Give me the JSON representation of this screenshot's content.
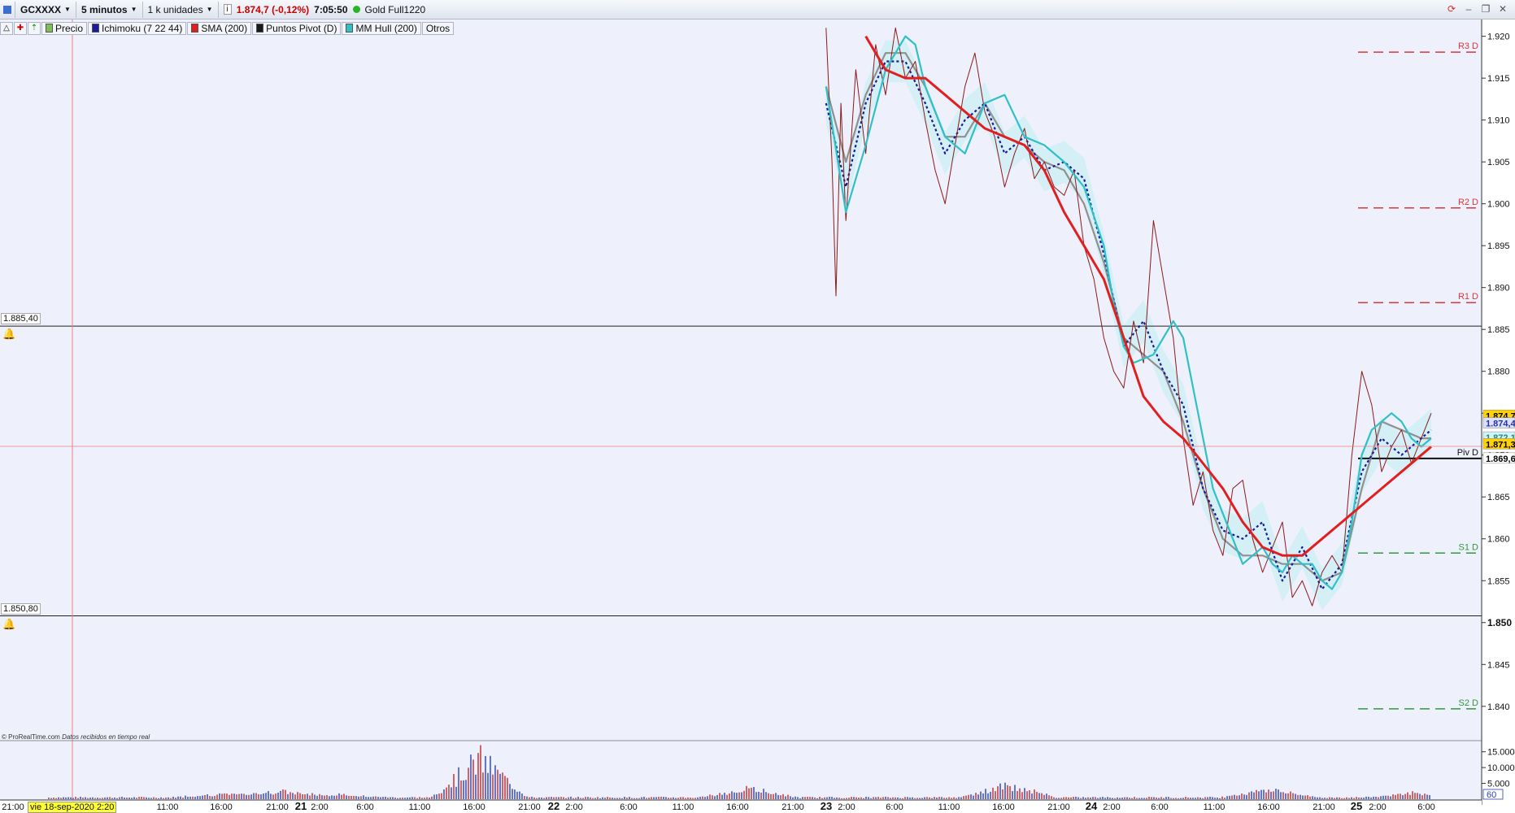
{
  "toolbar": {
    "symbol": "GCXXXX",
    "timeframe": "5 minutos",
    "units": "1 k unidades",
    "price_change": "1.874,7 (-0,12%)",
    "time": "7:05:50",
    "instrument": "Gold Full1220"
  },
  "indicators": {
    "items": [
      "Precio",
      "Ichimoku (7 22 44)",
      "SMA (200)",
      "Puntos Pivot (D)",
      "MM Hull (200)",
      "Otros"
    ],
    "colors": [
      "#7fbf5a",
      "#1a1a9a",
      "#e02020",
      "#1a1a1a",
      "#30c0c8",
      null
    ]
  },
  "credit": {
    "source": "© ProRealTime.com",
    "note": "Datos recibidos en tiempo real"
  },
  "cursor": {
    "date_label": "vie 18-sep-2020 2:20"
  },
  "hlines": [
    {
      "label": "1.885,40",
      "value": 1885.4
    },
    {
      "label": "1.850,80",
      "value": 1850.8
    }
  ],
  "price_labels": [
    {
      "text": "1.874,7",
      "value": 1874.7,
      "bg": "#ffd200",
      "fg": "#000"
    },
    {
      "text": "1.874,4",
      "value": 1873.8,
      "bg": "#dde0f8",
      "fg": "#2233aa"
    },
    {
      "text": "1.872,1",
      "value": 1872.1,
      "bg": "#d2f4f4",
      "fg": "#228888"
    },
    {
      "text": "1.871,3",
      "value": 1871.3,
      "bg": "#ffd200",
      "fg": "#000"
    },
    {
      "text": "1.869,6",
      "value": 1869.6,
      "bg": "#ffffff",
      "fg": "#000"
    }
  ],
  "pivots": [
    {
      "label": "R3 D",
      "value_label": "1.918,1",
      "value": 1918.1,
      "color": "#d83a3a"
    },
    {
      "label": "R2 D",
      "value_label": "1.899,5",
      "value": 1899.5,
      "color": "#d83a3a"
    },
    {
      "label": "R1 D",
      "value_label": "1.888,2",
      "value": 1888.2,
      "color": "#d83a3a"
    },
    {
      "label": "Piv D",
      "value_label": "",
      "value": 1869.6,
      "color": "#111111"
    },
    {
      "label": "S1 D",
      "value_label": "1.858,3",
      "value": 1858.3,
      "color": "#2e9a3e"
    },
    {
      "label": "S2 D",
      "value_label": "1.839,7",
      "value": 1839.7,
      "color": "#2e9a3e"
    }
  ],
  "chart_data": {
    "type": "line",
    "ylim": [
      1836,
      1922
    ],
    "y_ticks": [
      "1.920",
      "1.915",
      "1.910",
      "1.905",
      "1.900",
      "1.895",
      "1.890",
      "1.885",
      "1.880",
      "1.875",
      "1.870",
      "1.865",
      "1.860",
      "1.855",
      "1.850",
      "1.845",
      "1.840"
    ],
    "y_tick_values": [
      1920,
      1915,
      1910,
      1905,
      1900,
      1895,
      1890,
      1885,
      1880,
      1875,
      1870,
      1865,
      1860,
      1855,
      1850,
      1845,
      1840
    ],
    "bold_tick": "1.850",
    "x_ticks": [
      {
        "label": "21:00",
        "bold": false
      },
      {
        "label": "21",
        "bold": true
      },
      {
        "label": "2:00",
        "bold": false
      },
      {
        "label": "6:00",
        "bold": false
      },
      {
        "label": "11:00",
        "bold": false
      },
      {
        "label": "16:00",
        "bold": false
      },
      {
        "label": "21:00",
        "bold": false
      },
      {
        "label": "22",
        "bold": true
      },
      {
        "label": "2:00",
        "bold": false
      },
      {
        "label": "6:00",
        "bold": false
      },
      {
        "label": "11:00",
        "bold": false
      },
      {
        "label": "16:00",
        "bold": false
      },
      {
        "label": "21:00",
        "bold": false
      },
      {
        "label": "23",
        "bold": true
      },
      {
        "label": "2:00",
        "bold": false
      },
      {
        "label": "6:00",
        "bold": false
      },
      {
        "label": "11:00",
        "bold": false
      },
      {
        "label": "16:00",
        "bold": false
      },
      {
        "label": "21:00",
        "bold": false
      },
      {
        "label": "24",
        "bold": true
      },
      {
        "label": "2:00",
        "bold": false
      },
      {
        "label": "6:00",
        "bold": false
      },
      {
        "label": "11:00",
        "bold": false
      },
      {
        "label": "16:00",
        "bold": false
      },
      {
        "label": "21:00",
        "bold": false
      },
      {
        "label": "25",
        "bold": true
      },
      {
        "label": "2:00",
        "bold": false
      },
      {
        "label": "6:00",
        "bold": false
      }
    ],
    "left_ticks": [
      {
        "label": "21:00"
      },
      {
        "label": "11:00"
      },
      {
        "label": "16:00"
      },
      {
        "label": "21:00"
      }
    ],
    "volume_ticks": [
      "15.000",
      "10.000",
      "5.000"
    ],
    "volume_tick_values": [
      15000,
      10000,
      5000
    ],
    "volume_ylim": [
      0,
      18000
    ],
    "volume_box": "60",
    "series": [
      {
        "name": "Precio",
        "color": "#8b1a1a",
        "x": [
          0.39,
          0.396,
          0.4,
          0.405,
          0.41,
          0.42,
          0.43,
          0.44,
          0.45,
          0.46,
          0.47,
          0.48,
          0.49,
          0.5,
          0.51,
          0.52,
          0.53,
          0.54,
          0.55,
          0.56,
          0.57,
          0.58,
          0.59,
          0.6,
          0.61,
          0.62,
          0.63,
          0.64,
          0.65,
          0.66,
          0.67,
          0.68,
          0.69,
          0.7,
          0.71,
          0.72,
          0.73,
          0.74,
          0.75,
          0.76,
          0.77,
          0.78,
          0.79,
          0.8,
          0.81,
          0.82,
          0.83,
          0.84,
          0.85,
          0.86,
          0.87,
          0.88,
          0.89,
          0.9,
          0.91,
          0.92,
          0.93,
          0.94,
          0.95,
          0.96,
          0.97,
          0.98,
          0.99,
          1.0
        ],
        "y": [
          1921,
          1905,
          1889,
          1912,
          1898,
          1916,
          1906,
          1919,
          1913,
          1921,
          1915,
          1917,
          1910,
          1904,
          1900,
          1907,
          1914,
          1918,
          1911,
          1908,
          1902,
          1906,
          1909,
          1903,
          1905,
          1902,
          1901,
          1904,
          1895,
          1891,
          1884,
          1880,
          1878,
          1886,
          1881,
          1898,
          1891,
          1884,
          1872,
          1864,
          1868,
          1861,
          1858,
          1866,
          1867,
          1860,
          1856,
          1859,
          1862,
          1853,
          1855,
          1852,
          1856,
          1858,
          1856,
          1870,
          1880,
          1876,
          1868,
          1871,
          1873,
          1869,
          1872,
          1875
        ]
      },
      {
        "name": "MM Hull (200)",
        "color": "#30c0c8",
        "x": [
          0.39,
          0.41,
          0.43,
          0.45,
          0.47,
          0.48,
          0.49,
          0.51,
          0.53,
          0.55,
          0.57,
          0.59,
          0.61,
          0.63,
          0.65,
          0.67,
          0.68,
          0.69,
          0.7,
          0.72,
          0.74,
          0.75,
          0.76,
          0.78,
          0.8,
          0.81,
          0.82,
          0.83,
          0.84,
          0.85,
          0.86,
          0.87,
          0.88,
          0.89,
          0.9,
          0.91,
          0.92,
          0.93,
          0.94,
          0.95,
          0.96,
          0.97,
          0.98,
          0.99,
          1.0
        ],
        "y": [
          1914,
          1899,
          1907,
          1916,
          1920,
          1919,
          1914,
          1908,
          1906,
          1912,
          1913,
          1908,
          1907,
          1905,
          1902,
          1895,
          1888,
          1883,
          1881,
          1882,
          1886,
          1884,
          1878,
          1866,
          1860,
          1857,
          1858,
          1859,
          1857,
          1856,
          1858,
          1857,
          1857,
          1855,
          1854,
          1856,
          1862,
          1870,
          1873,
          1874,
          1875,
          1874,
          1872,
          1871,
          1872
        ]
      },
      {
        "name": "Ichimoku (7 22 44)",
        "color": "#1a1a9a",
        "dashed": true,
        "x": [
          0.39,
          0.41,
          0.43,
          0.45,
          0.47,
          0.49,
          0.51,
          0.53,
          0.55,
          0.57,
          0.59,
          0.61,
          0.63,
          0.65,
          0.67,
          0.69,
          0.71,
          0.73,
          0.75,
          0.77,
          0.79,
          0.81,
          0.83,
          0.85,
          0.87,
          0.89,
          0.91,
          0.93,
          0.95,
          0.97,
          0.99,
          1.0
        ],
        "y": [
          1912,
          1902,
          1912,
          1917,
          1917,
          1912,
          1906,
          1910,
          1912,
          1906,
          1908,
          1904,
          1905,
          1903,
          1894,
          1883,
          1886,
          1880,
          1876,
          1866,
          1861,
          1860,
          1862,
          1855,
          1859,
          1854,
          1857,
          1868,
          1872,
          1870,
          1872,
          1873
        ]
      },
      {
        "name": "SMA (200)",
        "color": "#e02020",
        "width": 3,
        "x": [
          0.43,
          0.45,
          0.47,
          0.49,
          0.51,
          0.53,
          0.55,
          0.57,
          0.59,
          0.61,
          0.63,
          0.65,
          0.67,
          0.69,
          0.71,
          0.73,
          0.75,
          0.77,
          0.79,
          0.81,
          0.83,
          0.85,
          0.87,
          0.89,
          0.91,
          0.93,
          0.95,
          0.97,
          0.99,
          1.0
        ],
        "y": [
          1920,
          1916,
          1915,
          1915,
          1913,
          1911,
          1909,
          1908,
          1907,
          1904,
          1899,
          1895,
          1891,
          1884,
          1877,
          1874,
          1872,
          1869,
          1866,
          1862,
          1859,
          1858,
          1858,
          1860,
          1862,
          1864,
          1866,
          1868,
          1870,
          1871
        ]
      },
      {
        "name": "Hull grey",
        "color": "#909090",
        "x": [
          0.39,
          0.41,
          0.43,
          0.45,
          0.47,
          0.49,
          0.51,
          0.53,
          0.55,
          0.57,
          0.59,
          0.61,
          0.63,
          0.65,
          0.67,
          0.69,
          0.71,
          0.73,
          0.75,
          0.77,
          0.79,
          0.81,
          0.83,
          0.85,
          0.87,
          0.89,
          0.91,
          0.93,
          0.95,
          0.97,
          0.99,
          1.0
        ],
        "y": [
          1914,
          1905,
          1913,
          1918,
          1918,
          1914,
          1908,
          1908,
          1912,
          1908,
          1907,
          1905,
          1904,
          1900,
          1893,
          1884,
          1882,
          1880,
          1874,
          1866,
          1860,
          1858,
          1858,
          1857,
          1857,
          1855,
          1856,
          1866,
          1874,
          1873,
          1872,
          1872
        ]
      }
    ]
  }
}
